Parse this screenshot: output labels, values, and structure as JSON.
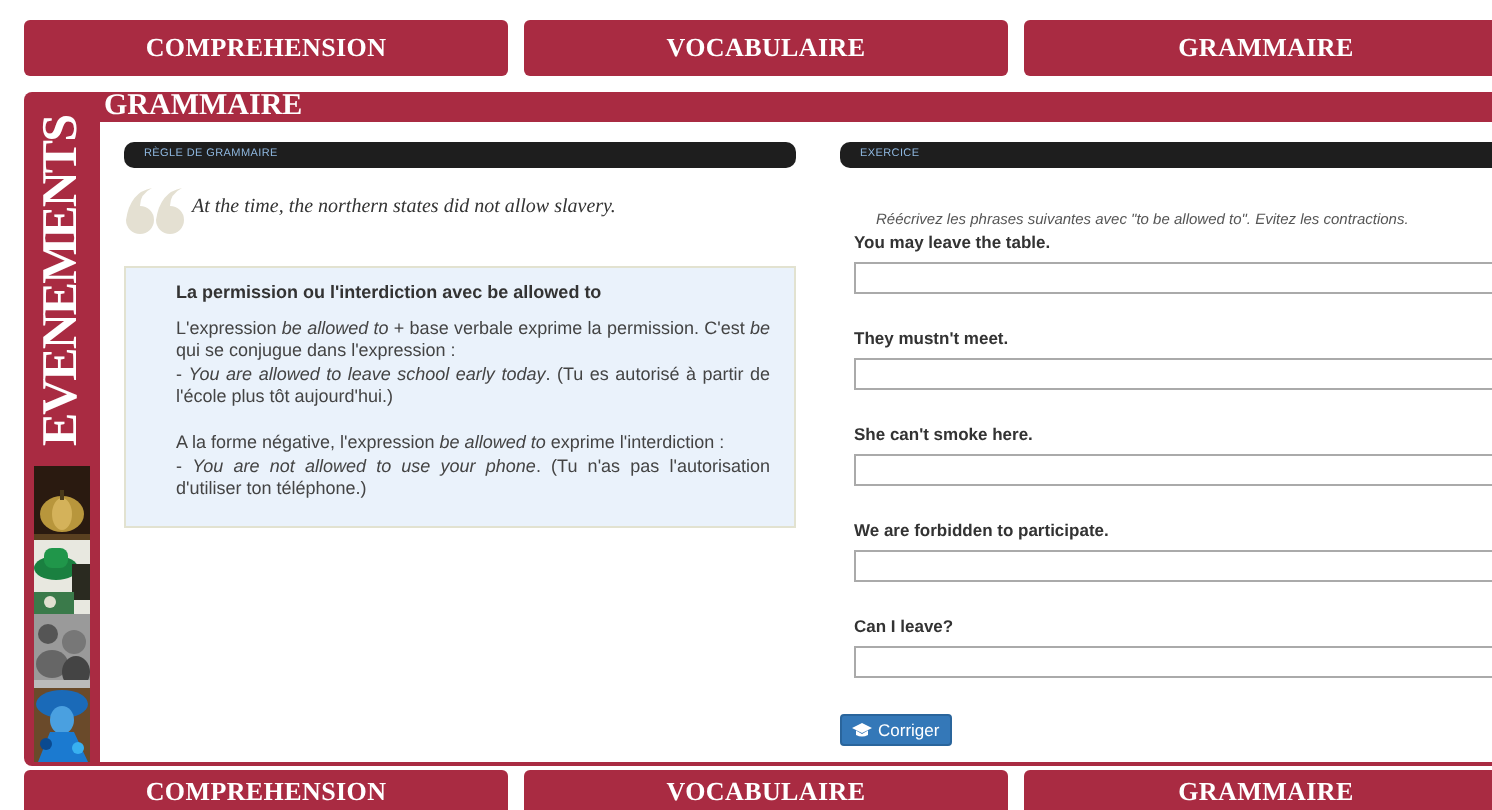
{
  "top_nav": [
    {
      "label": "COMPREHENSION"
    },
    {
      "label": "VOCABULAIRE"
    },
    {
      "label": "GRAMMAIRE"
    }
  ],
  "sidebar": {
    "title": "EVENEMENTS"
  },
  "section_title": "GRAMMAIRE",
  "rule_panel": {
    "header": "RÈGLE DE GRAMMAIRE",
    "quote": "At the time, the northern states did not allow slavery.",
    "box": {
      "title": "La permission ou l'interdiction avec be allowed to",
      "blocks": [
        [
          "L'expression *be allowed to* + base verbale exprime la permission. C'est *be* qui se conjugue dans l'expression :",
          "- *You are allowed to leave school early today*. (Tu es autorisé à partir de l'école plus tôt aujourd'hui.)"
        ],
        [
          "A la forme négative, l'expression *be allowed to* exprime l'interdiction :",
          "- *You are not allowed to use your phone*. (Tu n'as pas l'autorisation d'utiliser ton téléphone.)"
        ]
      ]
    }
  },
  "exercise_panel": {
    "header": "EXERCICE",
    "instruction": "Réécrivez les phrases suivantes avec \"to be allowed to\". Evitez les contractions.",
    "questions": [
      {
        "prompt": "You may leave the table."
      },
      {
        "prompt": "They mustn't meet."
      },
      {
        "prompt": "She can't smoke here."
      },
      {
        "prompt": "We are forbidden to participate."
      },
      {
        "prompt": "Can I leave?"
      }
    ],
    "submit_button": "Corriger"
  },
  "bottom_nav": [
    {
      "label": "COMPREHENSION"
    },
    {
      "label": "VOCABULAIRE"
    },
    {
      "label": "GRAMMAIRE"
    }
  ]
}
